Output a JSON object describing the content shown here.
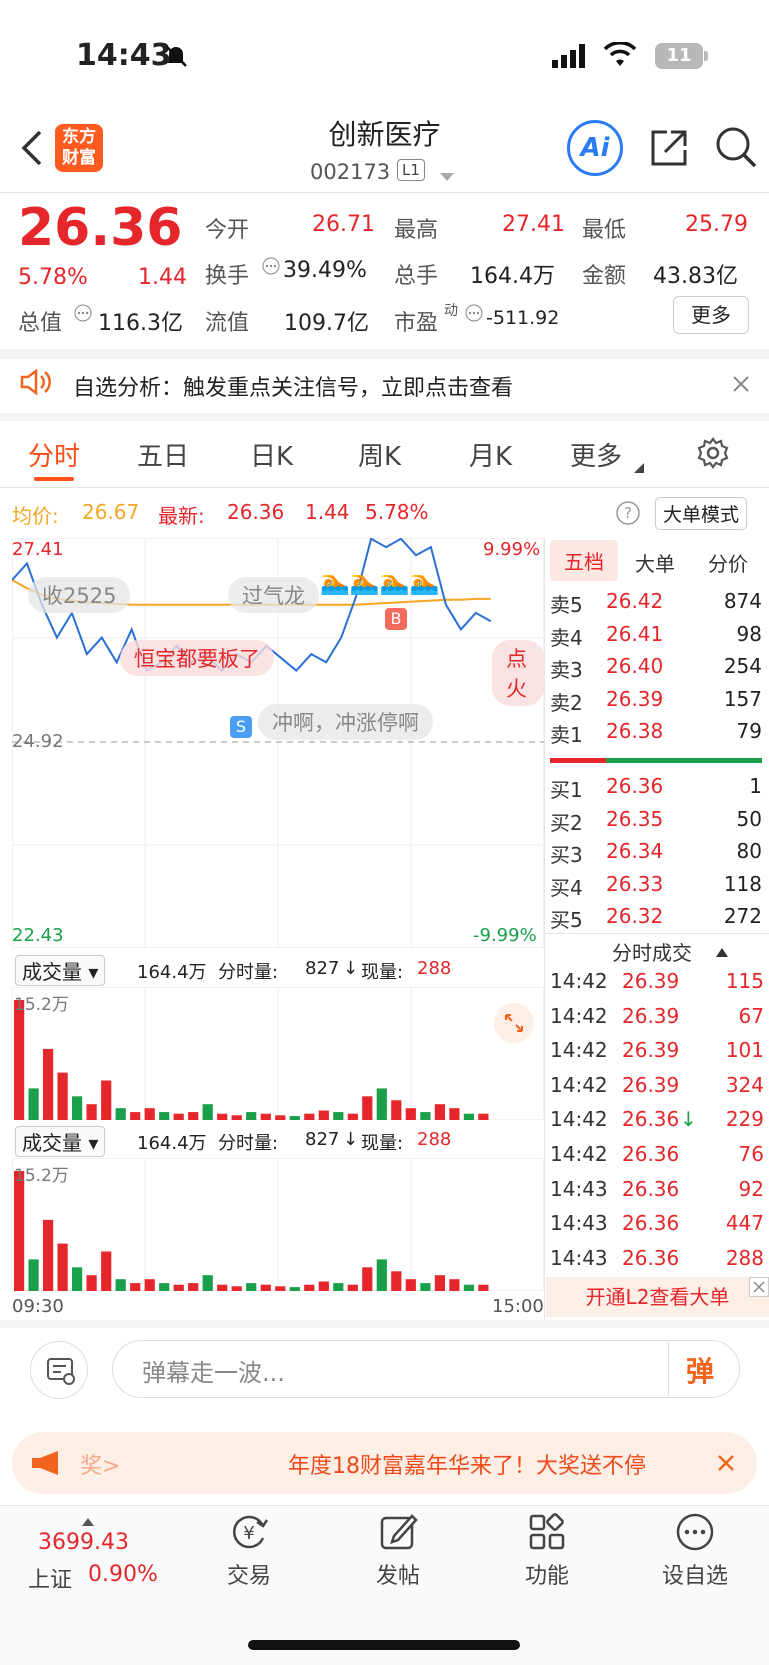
{
  "status_bar": {
    "time": "14:43",
    "battery": "11"
  },
  "header": {
    "title": "创新医疗",
    "code": "002173",
    "level": "L1",
    "logo_line1": "东方",
    "logo_line2": "财富",
    "ai_label": "Ai"
  },
  "quote": {
    "price": "26.36",
    "change_pct": "5.78%",
    "change": "1.44",
    "open_label": "今开",
    "open": "26.71",
    "high_label": "最高",
    "high": "27.41",
    "low_label": "最低",
    "low": "25.79",
    "turnover_label": "换手",
    "turnover": "39.49%",
    "volume_label": "总手",
    "volume": "164.4万",
    "amount_label": "金额",
    "amount": "43.83亿",
    "mcap_label": "总值",
    "mcap": "116.3亿",
    "float_label": "流值",
    "float": "109.7亿",
    "pe_label": "市盈",
    "pe_sup": "动",
    "pe": "-511.92",
    "more_label": "更多"
  },
  "notice": {
    "text": "自选分析：触发重点关注信号，立即点击查看"
  },
  "tabs": [
    "分时",
    "五日",
    "日K",
    "周K",
    "月K",
    "更多"
  ],
  "chart_info": {
    "avg_label": "均价:",
    "avg": "26.67",
    "latest_label": "最新:",
    "latest": "26.36",
    "change": "1.44",
    "pct": "5.78%",
    "mode_label": "大单模式"
  },
  "chart_labels": {
    "top_price": "27.41",
    "top_pct": "9.99%",
    "mid_price": "24.92",
    "bottom_price": "22.43",
    "bottom_pct": "-9.99%",
    "start_time": "09:30",
    "end_time": "15:00"
  },
  "danmaku": {
    "d1": "收2525",
    "d2": "过气龙",
    "d3": "恒宝都要板了",
    "d4": "冲啊，冲涨停啊",
    "d5": "点火"
  },
  "chart_data": {
    "type": "line",
    "title": "",
    "ylim": [
      22.43,
      27.41
    ],
    "reference": 24.92,
    "series": [
      {
        "values": [
          26.9,
          27.1,
          26.6,
          26.2,
          26.5,
          26.0,
          26.2,
          25.9,
          26.3,
          25.8,
          25.9,
          26.1,
          25.9,
          26.0,
          25.8,
          26.0,
          25.9,
          26.1,
          25.95,
          25.8,
          26.0,
          25.9,
          26.2,
          26.7,
          27.4,
          27.3,
          27.4,
          27.2,
          27.3,
          26.6,
          26.3,
          26.5,
          26.4
        ]
      },
      {
        "values": [
          26.9,
          26.8,
          26.72,
          26.67,
          26.65,
          26.63,
          26.62,
          26.61,
          26.6,
          26.6,
          26.6,
          26.6,
          26.6,
          26.6,
          26.6,
          26.6,
          26.6,
          26.6,
          26.6,
          26.6,
          26.6,
          26.6,
          26.6,
          26.6,
          26.61,
          26.62,
          26.63,
          26.64,
          26.65,
          26.66,
          26.66,
          26.67,
          26.67
        ]
      }
    ],
    "volume_max_label": "15.2万",
    "volume": [
      15.2,
      4,
      9,
      6,
      3,
      2,
      5,
      1.5,
      1,
      1.5,
      1,
      0.8,
      1,
      2,
      0.8,
      0.6,
      1,
      0.8,
      0.6,
      0.5,
      0.8,
      1.2,
      1,
      0.8,
      3,
      4,
      2.5,
      1.5,
      1,
      2,
      1.5,
      0.8,
      0.8
    ]
  },
  "volume_panel": {
    "select_label": "成交量",
    "total": "164.4万",
    "seg_label": "分时量:",
    "seg": "827",
    "now_label": "现量:",
    "now": "288"
  },
  "order_book": {
    "tabs": [
      "五档",
      "大单",
      "分价"
    ],
    "asks": [
      {
        "label": "卖5",
        "price": "26.42",
        "qty": "874"
      },
      {
        "label": "卖4",
        "price": "26.41",
        "qty": "98"
      },
      {
        "label": "卖3",
        "price": "26.40",
        "qty": "254"
      },
      {
        "label": "卖2",
        "price": "26.39",
        "qty": "157"
      },
      {
        "label": "卖1",
        "price": "26.38",
        "qty": "79"
      }
    ],
    "bids": [
      {
        "label": "买1",
        "price": "26.36",
        "qty": "1"
      },
      {
        "label": "买2",
        "price": "26.35",
        "qty": "50"
      },
      {
        "label": "买3",
        "price": "26.34",
        "qty": "80"
      },
      {
        "label": "买4",
        "price": "26.33",
        "qty": "118"
      },
      {
        "label": "买5",
        "price": "26.32",
        "qty": "272"
      }
    ]
  },
  "trades": {
    "title": "分时成交",
    "rows": [
      {
        "time": "14:42",
        "price": "26.39",
        "qty": "115",
        "dir": ""
      },
      {
        "time": "14:42",
        "price": "26.39",
        "qty": "67",
        "dir": ""
      },
      {
        "time": "14:42",
        "price": "26.39",
        "qty": "101",
        "dir": ""
      },
      {
        "time": "14:42",
        "price": "26.39",
        "qty": "324",
        "dir": ""
      },
      {
        "time": "14:42",
        "price": "26.36",
        "qty": "229",
        "dir": "↓"
      },
      {
        "time": "14:42",
        "price": "26.36",
        "qty": "76",
        "dir": ""
      },
      {
        "time": "14:43",
        "price": "26.36",
        "qty": "92",
        "dir": ""
      },
      {
        "time": "14:43",
        "price": "26.36",
        "qty": "447",
        "dir": ""
      },
      {
        "time": "14:43",
        "price": "26.36",
        "qty": "288",
        "dir": ""
      }
    ],
    "l2_label": "开通L2查看大单"
  },
  "danmu_input": {
    "placeholder": "弹幕走一波...",
    "button": "弹"
  },
  "ad": {
    "prefix": "奖>",
    "text": "年度18财富嘉年华来了！大奖送不停"
  },
  "bottom_nav": {
    "index_value": "3699.43",
    "index_name": "上证",
    "index_pct": "0.90%",
    "items": [
      "交易",
      "发帖",
      "功能",
      "设自选"
    ]
  },
  "colors": {
    "up": "#e5262b",
    "down": "#1aa04a",
    "accent": "#ff4e17",
    "avg_line": "#f5a623",
    "price_line": "#2a6fd6"
  }
}
